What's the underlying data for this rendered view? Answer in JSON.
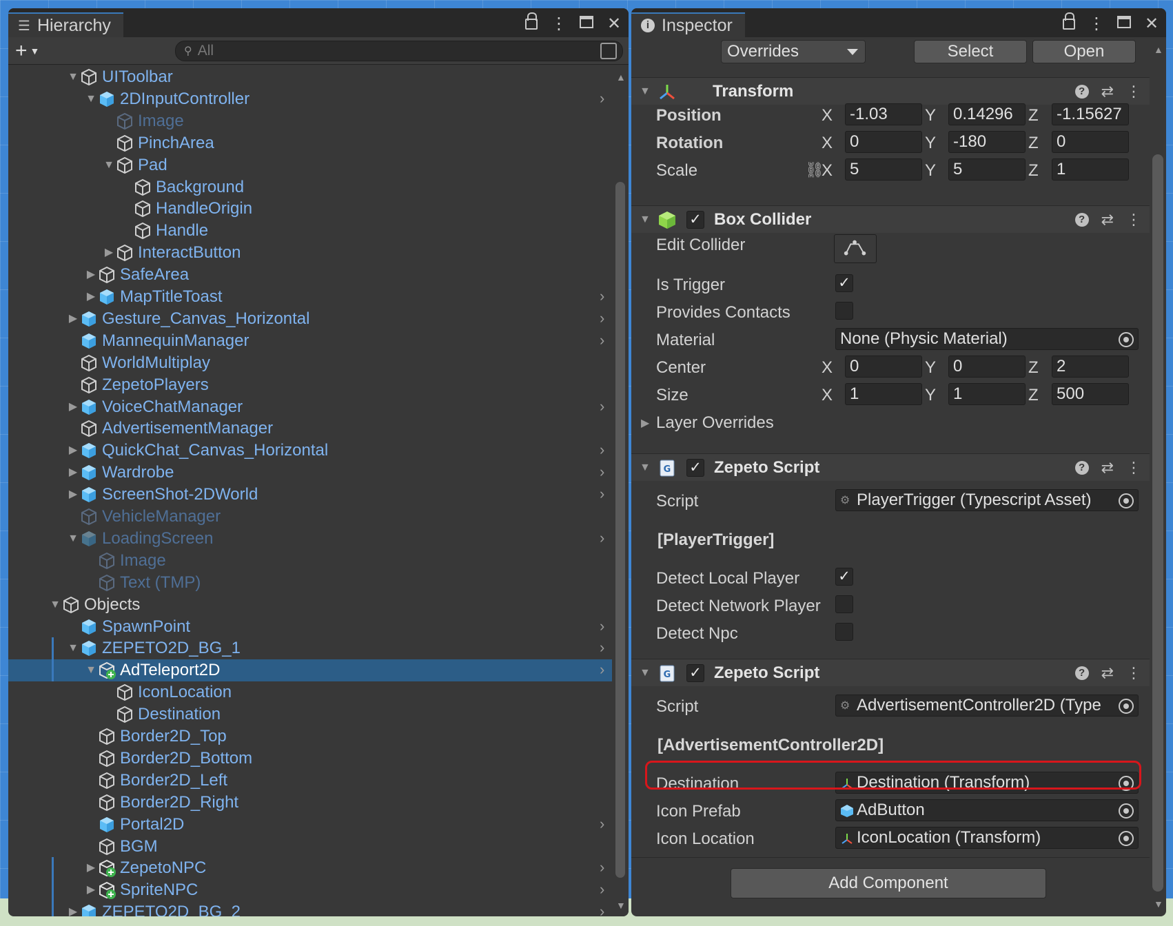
{
  "hierarchy": {
    "tab_title": "Hierarchy",
    "search_placeholder": "All",
    "rows": [
      {
        "label": "UIToolbar",
        "depth": 4,
        "fold": "open",
        "icon": "gameobject-icon",
        "color": "link",
        "chevron": false,
        "bar": false,
        "selected": false
      },
      {
        "label": "2DInputController",
        "depth": 5,
        "fold": "open",
        "icon": "prefab-icon",
        "color": "link",
        "chevron": true,
        "bar": false,
        "selected": false
      },
      {
        "label": "Image",
        "depth": 6,
        "fold": "none",
        "icon": "gameobject-icon",
        "color": "dim",
        "chevron": false,
        "bar": false,
        "selected": false
      },
      {
        "label": "PinchArea",
        "depth": 6,
        "fold": "none",
        "icon": "gameobject-icon",
        "color": "link",
        "chevron": false,
        "bar": false,
        "selected": false
      },
      {
        "label": "Pad",
        "depth": 6,
        "fold": "open",
        "icon": "gameobject-icon",
        "color": "link",
        "chevron": false,
        "bar": false,
        "selected": false
      },
      {
        "label": "Background",
        "depth": 7,
        "fold": "none",
        "icon": "gameobject-icon",
        "color": "link",
        "chevron": false,
        "bar": false,
        "selected": false
      },
      {
        "label": "HandleOrigin",
        "depth": 7,
        "fold": "none",
        "icon": "gameobject-icon",
        "color": "link",
        "chevron": false,
        "bar": false,
        "selected": false
      },
      {
        "label": "Handle",
        "depth": 7,
        "fold": "none",
        "icon": "gameobject-icon",
        "color": "link",
        "chevron": false,
        "bar": false,
        "selected": false
      },
      {
        "label": "InteractButton",
        "depth": 6,
        "fold": "closed",
        "icon": "gameobject-icon",
        "color": "link",
        "chevron": false,
        "bar": false,
        "selected": false
      },
      {
        "label": "SafeArea",
        "depth": 5,
        "fold": "closed",
        "icon": "gameobject-icon",
        "color": "link",
        "chevron": false,
        "bar": false,
        "selected": false
      },
      {
        "label": "MapTitleToast",
        "depth": 5,
        "fold": "closed",
        "icon": "prefab-icon",
        "color": "link",
        "chevron": true,
        "bar": false,
        "selected": false
      },
      {
        "label": "Gesture_Canvas_Horizontal",
        "depth": 4,
        "fold": "closed",
        "icon": "prefab-icon",
        "color": "link",
        "chevron": true,
        "bar": false,
        "selected": false
      },
      {
        "label": "MannequinManager",
        "depth": 4,
        "fold": "none",
        "icon": "prefab-icon",
        "color": "link",
        "chevron": true,
        "bar": false,
        "selected": false
      },
      {
        "label": "WorldMultiplay",
        "depth": 4,
        "fold": "none",
        "icon": "gameobject-icon",
        "color": "link",
        "chevron": false,
        "bar": false,
        "selected": false
      },
      {
        "label": "ZepetoPlayers",
        "depth": 4,
        "fold": "none",
        "icon": "gameobject-icon",
        "color": "link",
        "chevron": false,
        "bar": false,
        "selected": false
      },
      {
        "label": "VoiceChatManager",
        "depth": 4,
        "fold": "closed",
        "icon": "prefab-icon",
        "color": "link",
        "chevron": true,
        "bar": false,
        "selected": false
      },
      {
        "label": "AdvertisementManager",
        "depth": 4,
        "fold": "none",
        "icon": "gameobject-icon",
        "color": "link",
        "chevron": false,
        "bar": false,
        "selected": false
      },
      {
        "label": "QuickChat_Canvas_Horizontal",
        "depth": 4,
        "fold": "closed",
        "icon": "prefab-icon",
        "color": "link",
        "chevron": true,
        "bar": false,
        "selected": false
      },
      {
        "label": "Wardrobe",
        "depth": 4,
        "fold": "closed",
        "icon": "prefab-icon",
        "color": "link",
        "chevron": true,
        "bar": false,
        "selected": false
      },
      {
        "label": "ScreenShot-2DWorld",
        "depth": 4,
        "fold": "closed",
        "icon": "prefab-icon",
        "color": "link",
        "chevron": true,
        "bar": false,
        "selected": false
      },
      {
        "label": "VehicleManager",
        "depth": 4,
        "fold": "none",
        "icon": "gameobject-icon",
        "color": "dim",
        "chevron": false,
        "bar": false,
        "selected": false
      },
      {
        "label": "LoadingScreen",
        "depth": 4,
        "fold": "open",
        "icon": "prefab-icon",
        "color": "dim",
        "chevron": true,
        "bar": false,
        "selected": false
      },
      {
        "label": "Image",
        "depth": 5,
        "fold": "none",
        "icon": "gameobject-icon",
        "color": "dim",
        "chevron": false,
        "bar": false,
        "selected": false
      },
      {
        "label": "Text (TMP)",
        "depth": 5,
        "fold": "none",
        "icon": "gameobject-icon",
        "color": "dim",
        "chevron": false,
        "bar": false,
        "selected": false
      },
      {
        "label": "Objects",
        "depth": 3,
        "fold": "open",
        "icon": "gameobject-icon",
        "color": "white",
        "chevron": false,
        "bar": false,
        "selected": false
      },
      {
        "label": "SpawnPoint",
        "depth": 4,
        "fold": "none",
        "icon": "prefab-icon",
        "color": "link",
        "chevron": true,
        "bar": false,
        "selected": false
      },
      {
        "label": "ZEPETO2D_BG_1",
        "depth": 4,
        "fold": "open",
        "icon": "prefab-icon",
        "color": "link",
        "chevron": true,
        "bar": true,
        "selected": false
      },
      {
        "label": "AdTeleport2D",
        "depth": 5,
        "fold": "open",
        "icon": "prefab-added-icon",
        "color": "link",
        "chevron": true,
        "bar": true,
        "selected": true
      },
      {
        "label": "IconLocation",
        "depth": 6,
        "fold": "none",
        "icon": "gameobject-icon",
        "color": "link",
        "chevron": false,
        "bar": false,
        "selected": false
      },
      {
        "label": "Destination",
        "depth": 6,
        "fold": "none",
        "icon": "gameobject-icon",
        "color": "link",
        "chevron": false,
        "bar": false,
        "selected": false
      },
      {
        "label": "Border2D_Top",
        "depth": 5,
        "fold": "none",
        "icon": "gameobject-icon",
        "color": "link",
        "chevron": false,
        "bar": false,
        "selected": false
      },
      {
        "label": "Border2D_Bottom",
        "depth": 5,
        "fold": "none",
        "icon": "gameobject-icon",
        "color": "link",
        "chevron": false,
        "bar": false,
        "selected": false
      },
      {
        "label": "Border2D_Left",
        "depth": 5,
        "fold": "none",
        "icon": "gameobject-icon",
        "color": "link",
        "chevron": false,
        "bar": false,
        "selected": false
      },
      {
        "label": "Border2D_Right",
        "depth": 5,
        "fold": "none",
        "icon": "gameobject-icon",
        "color": "link",
        "chevron": false,
        "bar": false,
        "selected": false
      },
      {
        "label": "Portal2D",
        "depth": 5,
        "fold": "none",
        "icon": "prefab-icon",
        "color": "link",
        "chevron": true,
        "bar": false,
        "selected": false
      },
      {
        "label": "BGM",
        "depth": 5,
        "fold": "none",
        "icon": "gameobject-icon",
        "color": "link",
        "chevron": false,
        "bar": false,
        "selected": false
      },
      {
        "label": "ZepetoNPC",
        "depth": 5,
        "fold": "closed",
        "icon": "prefab-added-icon",
        "color": "link",
        "chevron": true,
        "bar": true,
        "selected": false
      },
      {
        "label": "SpriteNPC",
        "depth": 5,
        "fold": "closed",
        "icon": "prefab-added-icon",
        "color": "link",
        "chevron": true,
        "bar": true,
        "selected": false
      },
      {
        "label": "ZEPETO2D_BG_2",
        "depth": 4,
        "fold": "closed",
        "icon": "prefab-icon",
        "color": "link",
        "chevron": true,
        "bar": true,
        "selected": false
      }
    ]
  },
  "inspector": {
    "tab_title": "Inspector",
    "overrides_label": "Overrides",
    "select_label": "Select",
    "open_label": "Open",
    "transform": {
      "title": "Transform",
      "position_label": "Position",
      "rotation_label": "Rotation",
      "scale_label": "Scale",
      "position": {
        "x": "-1.03",
        "y": "0.14296",
        "z": "-1.15627"
      },
      "rotation": {
        "x": "0",
        "y": "-180",
        "z": "0"
      },
      "scale": {
        "x": "5",
        "y": "5",
        "z": "1"
      }
    },
    "box_collider": {
      "title": "Box Collider",
      "edit_collider_label": "Edit Collider",
      "is_trigger_label": "Is Trigger",
      "is_trigger": true,
      "provides_contacts_label": "Provides Contacts",
      "provides_contacts": false,
      "material_label": "Material",
      "material_value": "None (Physic Material)",
      "center_label": "Center",
      "center": {
        "x": "0",
        "y": "0",
        "z": "2"
      },
      "size_label": "Size",
      "size": {
        "x": "1",
        "y": "1",
        "z": "500"
      },
      "layer_overrides_label": "Layer Overrides"
    },
    "zepeto_script_1": {
      "title": "Zepeto Script",
      "script_label": "Script",
      "script_value": "PlayerTrigger (Typescript Asset)",
      "class_name": "[PlayerTrigger]",
      "detect_local_label": "Detect Local Player",
      "detect_local": true,
      "detect_network_label": "Detect Network Player",
      "detect_network": false,
      "detect_npc_label": "Detect Npc",
      "detect_npc": false
    },
    "zepeto_script_2": {
      "title": "Zepeto Script",
      "script_label": "Script",
      "script_value": "AdvertisementController2D (Type",
      "class_name": "[AdvertisementController2D]",
      "destination_label": "Destination",
      "destination_value": "Destination (Transform)",
      "icon_prefab_label": "Icon Prefab",
      "icon_prefab_value": "AdButton",
      "icon_location_label": "Icon Location",
      "icon_location_value": "IconLocation (Transform)"
    },
    "add_component_label": "Add Component",
    "axis_x": "X",
    "axis_y": "Y",
    "axis_z": "Z"
  },
  "colors": {
    "link": "#7fb3ef",
    "dim": "#4f6f96",
    "selection": "#2c5d87",
    "highlight": "#d8161b",
    "prefab": "#5bbcf5"
  }
}
